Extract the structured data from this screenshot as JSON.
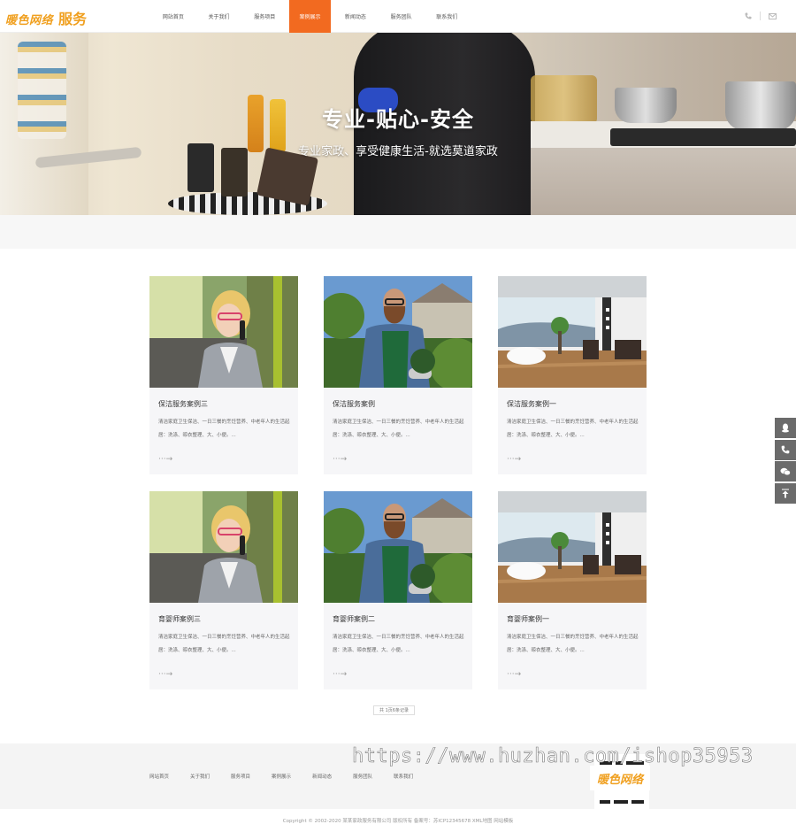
{
  "header": {
    "logo_text": "暖色网络",
    "logo_text2": "服务",
    "nav": [
      {
        "label": "网站首页",
        "active": false
      },
      {
        "label": "关于我们",
        "active": false
      },
      {
        "label": "服务项目",
        "active": false
      },
      {
        "label": "案例展示",
        "active": true
      },
      {
        "label": "新闻动态",
        "active": false
      },
      {
        "label": "服务团队",
        "active": false
      },
      {
        "label": "联系我们",
        "active": false
      }
    ],
    "icons": [
      "phone-icon",
      "mail-icon"
    ]
  },
  "banner": {
    "title": "专业-贴心-安全",
    "subtitle": "专业家政、享受健康生活-就选莫道家政"
  },
  "cards": [
    {
      "title": "保洁服务案例三",
      "desc": "清洁家庭卫生保洁、一日三餐的烹饪营养、中老年人的生活起居：洗涤、晾衣整理、大、小便。...",
      "arrow": "···→",
      "image": "woman-phone"
    },
    {
      "title": "保洁服务案例",
      "desc": "清洁家庭卫生保洁、一日三餐的烹饪营养、中老年人的生活起居：洗涤、晾衣整理、大、小便。...",
      "arrow": "···→",
      "image": "gardener"
    },
    {
      "title": "保洁服务案例一",
      "desc": "清洁家庭卫生保洁、一日三餐的烹饪营养、中老年人的生活起居：洗涤、晾衣整理、大、小便。...",
      "arrow": "···→",
      "image": "bathroom"
    },
    {
      "title": "育婴师案例三",
      "desc": "清洁家庭卫生保洁、一日三餐的烹饪营养、中老年人的生活起居：洗涤、晾衣整理、大、小便。...",
      "arrow": "···→",
      "image": "woman-phone"
    },
    {
      "title": "育婴师案例二",
      "desc": "清洁家庭卫生保洁、一日三餐的烹饪营养、中老年人的生活起居：洗涤、晾衣整理、大、小便。...",
      "arrow": "···→",
      "image": "gardener"
    },
    {
      "title": "育婴师案例一",
      "desc": "清洁家庭卫生保洁、一日三餐的烹饪营养、中老年人的生活起居：洗涤、晾衣整理、大、小便。...",
      "arrow": "···→",
      "image": "bathroom"
    }
  ],
  "pager": {
    "label": "共 1页6条记录"
  },
  "footer": {
    "nav": [
      "网站首页",
      "关于我们",
      "服务项目",
      "案例展示",
      "新闻动态",
      "服务团队",
      "联系我们"
    ],
    "watermark_url": "https://www.huzhan.com/ishop35953",
    "watermark_logo": "暖色网络",
    "copyright": "Copyright © 2002-2020 某某家政服务有限公司 版权所有 备案号：苏ICP12345678 XML地图 网站模板"
  },
  "float_bar": [
    "qq-icon",
    "phone-icon",
    "wechat-icon",
    "back-to-top-icon"
  ],
  "colors": {
    "accent": "#f26a20",
    "logo": "#f0a020",
    "float_bg": "#6b6b6b"
  }
}
